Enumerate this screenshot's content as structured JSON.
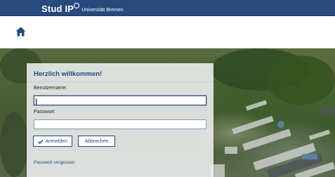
{
  "header": {
    "logo_text": "Stud IP",
    "university": "Universität Bremen"
  },
  "nav": {
    "home_icon": "home-icon"
  },
  "login": {
    "title": "Herzlich willkommen!",
    "username_label": "Benutzername:",
    "username_value": "",
    "password_label": "Passwort:",
    "password_value": "",
    "login_button": "Anmelden",
    "login_icon": "check-icon",
    "cancel_button": "Abbrechen",
    "forgot_link": "Passwort vergessen"
  },
  "colors": {
    "brand": "#28497c",
    "topbar": "#28497c"
  }
}
